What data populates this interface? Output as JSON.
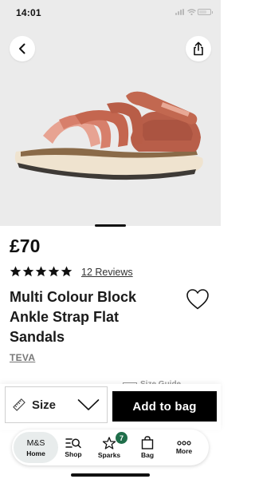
{
  "status_bar": {
    "time": "14:01"
  },
  "product": {
    "price": "£70",
    "rating": 5,
    "rating_max": 5,
    "reviews_label": "12 Reviews",
    "title": "Multi Colour Block Ankle Strap Flat Sandals",
    "brand": "TEVA",
    "image_pages": {
      "current": 1
    }
  },
  "size_guide": {
    "label": "Size Guide"
  },
  "action_bar": {
    "size_label": "Size",
    "add_label": "Add to bag"
  },
  "bottom_nav": {
    "home_logo": "M&S",
    "items": [
      {
        "label": "Home",
        "icon": "ms-logo",
        "active": true
      },
      {
        "label": "Shop",
        "icon": "search-grid-icon"
      },
      {
        "label": "Sparks",
        "icon": "sparks-star-icon",
        "badge": "7"
      },
      {
        "label": "Bag",
        "icon": "bag-icon"
      },
      {
        "label": "More",
        "icon": "more-dots-icon"
      }
    ]
  },
  "colors": {
    "accent": "#000000",
    "badge": "#1f6e4a",
    "hero_bg": "#ebebeb"
  }
}
